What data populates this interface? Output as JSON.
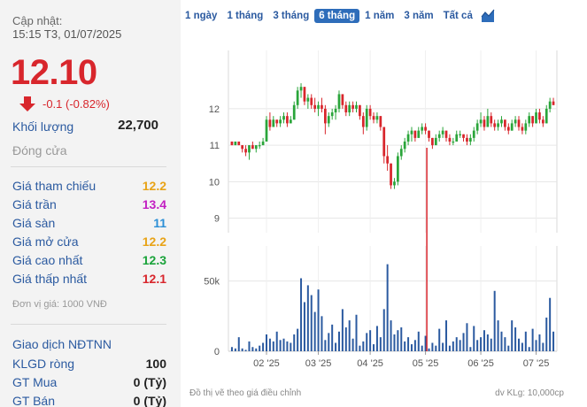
{
  "update": {
    "label": "Cập nhật:",
    "time": "15:15 T3, 01/07/2025"
  },
  "price": {
    "value": "12.10",
    "change": "-0.1 (-0.82%)"
  },
  "volume": {
    "label": "Khối lượng",
    "value": "22,700"
  },
  "close": {
    "label": "Đóng cửa"
  },
  "stats": [
    {
      "label": "Giá tham chiếu",
      "value": "12.2",
      "color": "#e8a317"
    },
    {
      "label": "Giá trần",
      "value": "13.4",
      "color": "#c21fc2"
    },
    {
      "label": "Giá sàn",
      "value": "11",
      "color": "#2b8fd6"
    },
    {
      "label": "Giá mở cửa",
      "value": "12.2",
      "color": "#e8a317"
    },
    {
      "label": "Giá cao nhất",
      "value": "12.3",
      "color": "#1aa33a"
    },
    {
      "label": "Giá thấp nhất",
      "value": "12.1",
      "color": "#d8262c"
    }
  ],
  "unit_note": "Đơn vị giá: 1000 VNĐ",
  "foreign": {
    "title": "Giao dịch NĐTNN",
    "rows": [
      {
        "label": "KLGD ròng",
        "value": "100"
      },
      {
        "label": "GT Mua",
        "value": "0 (Tỷ)"
      },
      {
        "label": "GT Bán",
        "value": "0 (Tỷ)"
      }
    ]
  },
  "tabs": [
    {
      "label": "1 ngày",
      "active": false
    },
    {
      "label": "1 tháng",
      "active": false
    },
    {
      "label": "3 tháng",
      "active": false
    },
    {
      "label": "6 tháng",
      "active": true
    },
    {
      "label": "1 năm",
      "active": false
    },
    {
      "label": "3 năm",
      "active": false
    },
    {
      "label": "Tất cả",
      "active": false
    }
  ],
  "chart_icon": "area-chart-icon",
  "footer": {
    "left": "Đồ thị vẽ theo giá điều chỉnh",
    "right": "dv KLg: 10,000cp"
  },
  "chart_data": {
    "type": "candlestick",
    "price_ticks": [
      "12",
      "11",
      "10",
      "9"
    ],
    "price_range": [
      8.6,
      13.6
    ],
    "volume_ticks": [
      "50k",
      "0"
    ],
    "volume_range": [
      0,
      75
    ],
    "x_ticks": [
      "02 '25",
      "03 '25",
      "04 '25",
      "05 '25",
      "06 '25",
      "07 '25"
    ],
    "colors": {
      "up": "#2aa53a",
      "down": "#d8262c",
      "volume": "#2b5aa0",
      "marker": "#d8262c"
    },
    "candles": [
      [
        11.1,
        11.1,
        11.0,
        11.0
      ],
      [
        11.0,
        11.1,
        11.0,
        11.1
      ],
      [
        11.1,
        11.1,
        11.0,
        11.0
      ],
      [
        11.0,
        11.0,
        10.8,
        10.9
      ],
      [
        10.9,
        11.0,
        10.7,
        10.8
      ],
      [
        10.8,
        11.0,
        10.6,
        11.0
      ],
      [
        11.0,
        11.1,
        10.9,
        10.9
      ],
      [
        10.9,
        11.0,
        10.8,
        11.0
      ],
      [
        11.0,
        11.1,
        10.9,
        11.0
      ],
      [
        11.0,
        11.2,
        11.0,
        11.1
      ],
      [
        11.1,
        11.8,
        11.1,
        11.7
      ],
      [
        11.7,
        11.9,
        11.4,
        11.5
      ],
      [
        11.5,
        11.8,
        11.5,
        11.7
      ],
      [
        11.7,
        11.7,
        11.5,
        11.6
      ],
      [
        11.6,
        11.8,
        11.5,
        11.7
      ],
      [
        11.7,
        11.9,
        11.6,
        11.8
      ],
      [
        11.8,
        11.9,
        11.5,
        11.6
      ],
      [
        11.6,
        11.8,
        11.6,
        11.7
      ],
      [
        11.7,
        12.2,
        11.7,
        12.1
      ],
      [
        12.1,
        12.6,
        12.0,
        12.5
      ],
      [
        12.5,
        12.7,
        12.3,
        12.6
      ],
      [
        12.6,
        12.6,
        12.1,
        12.2
      ],
      [
        12.2,
        12.4,
        12.0,
        12.3
      ],
      [
        12.3,
        12.4,
        12.0,
        12.1
      ],
      [
        12.1,
        12.3,
        11.9,
        12.0
      ],
      [
        12.0,
        12.2,
        11.8,
        12.1
      ],
      [
        12.1,
        12.3,
        11.9,
        12.0
      ],
      [
        12.0,
        12.1,
        11.3,
        11.6
      ],
      [
        11.6,
        11.9,
        11.5,
        11.8
      ],
      [
        11.8,
        12.0,
        11.7,
        11.9
      ],
      [
        11.9,
        12.1,
        11.7,
        12.0
      ],
      [
        12.0,
        12.5,
        11.9,
        12.4
      ],
      [
        12.4,
        12.4,
        12.0,
        12.1
      ],
      [
        12.1,
        12.2,
        11.8,
        11.9
      ],
      [
        11.9,
        12.2,
        11.8,
        12.1
      ],
      [
        12.1,
        12.2,
        11.9,
        12.0
      ],
      [
        12.0,
        12.2,
        11.9,
        12.1
      ],
      [
        12.1,
        12.1,
        11.7,
        11.8
      ],
      [
        11.8,
        11.9,
        11.3,
        11.5
      ],
      [
        11.5,
        12.1,
        11.4,
        12.0
      ],
      [
        12.0,
        12.1,
        11.7,
        11.8
      ],
      [
        11.8,
        11.9,
        11.6,
        11.7
      ],
      [
        11.7,
        11.9,
        11.6,
        11.8
      ],
      [
        11.8,
        11.8,
        11.4,
        11.5
      ],
      [
        11.5,
        11.5,
        10.5,
        10.7
      ],
      [
        10.7,
        11.0,
        10.3,
        10.5
      ],
      [
        10.5,
        10.5,
        9.8,
        9.9
      ],
      [
        9.9,
        10.1,
        9.8,
        10.0
      ],
      [
        10.0,
        10.8,
        9.9,
        10.7
      ],
      [
        10.7,
        11.0,
        10.6,
        10.9
      ],
      [
        10.9,
        11.2,
        10.8,
        11.1
      ],
      [
        11.1,
        11.4,
        11.0,
        11.3
      ],
      [
        11.3,
        11.5,
        11.1,
        11.4
      ],
      [
        11.4,
        11.4,
        11.1,
        11.2
      ],
      [
        11.2,
        11.5,
        11.2,
        11.4
      ],
      [
        11.4,
        11.6,
        11.3,
        11.5
      ],
      [
        11.5,
        11.6,
        11.3,
        11.4
      ],
      [
        11.4,
        11.4,
        11.1,
        11.2
      ],
      [
        11.2,
        11.2,
        10.9,
        11.0
      ],
      [
        11.0,
        11.3,
        11.0,
        11.2
      ],
      [
        11.2,
        11.4,
        11.1,
        11.3
      ],
      [
        11.3,
        11.5,
        11.2,
        11.4
      ],
      [
        11.4,
        11.4,
        11.1,
        11.2
      ],
      [
        11.2,
        11.3,
        11.0,
        11.1
      ],
      [
        11.1,
        11.2,
        11.0,
        11.1
      ],
      [
        11.1,
        11.4,
        11.1,
        11.3
      ],
      [
        11.3,
        11.4,
        11.2,
        11.3
      ],
      [
        11.3,
        11.3,
        11.1,
        11.2
      ],
      [
        11.2,
        11.3,
        11.0,
        11.1
      ],
      [
        11.1,
        11.3,
        11.0,
        11.2
      ],
      [
        11.2,
        11.5,
        11.1,
        11.4
      ],
      [
        11.4,
        11.7,
        11.3,
        11.6
      ],
      [
        11.6,
        11.9,
        11.5,
        11.7
      ],
      [
        11.7,
        11.8,
        11.4,
        11.5
      ],
      [
        11.5,
        12.0,
        11.5,
        11.8
      ],
      [
        11.8,
        11.9,
        11.5,
        11.6
      ],
      [
        11.6,
        11.7,
        11.4,
        11.5
      ],
      [
        11.5,
        11.7,
        11.4,
        11.6
      ],
      [
        11.6,
        11.8,
        11.5,
        11.7
      ],
      [
        11.7,
        11.7,
        11.4,
        11.5
      ],
      [
        11.5,
        11.6,
        11.3,
        11.4
      ],
      [
        11.4,
        11.7,
        11.4,
        11.6
      ],
      [
        11.6,
        11.8,
        11.5,
        11.7
      ],
      [
        11.7,
        11.8,
        11.4,
        11.5
      ],
      [
        11.5,
        11.6,
        11.3,
        11.4
      ],
      [
        11.4,
        11.7,
        11.3,
        11.6
      ],
      [
        11.6,
        11.9,
        11.5,
        11.8
      ],
      [
        11.8,
        11.8,
        11.5,
        11.6
      ],
      [
        11.6,
        12.0,
        11.6,
        11.9
      ],
      [
        11.9,
        12.0,
        11.6,
        11.7
      ],
      [
        11.7,
        11.8,
        11.5,
        11.6
      ],
      [
        11.6,
        12.1,
        11.6,
        12.0
      ],
      [
        12.0,
        12.3,
        11.9,
        12.2
      ],
      [
        12.2,
        12.3,
        12.1,
        12.1
      ]
    ],
    "volumes": [
      3,
      2,
      10,
      2,
      1,
      7,
      3,
      2,
      4,
      6,
      12,
      9,
      7,
      14,
      8,
      9,
      7,
      6,
      12,
      16,
      52,
      35,
      47,
      40,
      28,
      44,
      25,
      8,
      13,
      19,
      6,
      14,
      30,
      17,
      22,
      9,
      26,
      4,
      7,
      13,
      15,
      5,
      18,
      10,
      30,
      62,
      22,
      12,
      15,
      17,
      7,
      10,
      5,
      8,
      14,
      4,
      11,
      2,
      6,
      4,
      16,
      6,
      22,
      4,
      7,
      10,
      8,
      13,
      20,
      3,
      18,
      8,
      10,
      15,
      12,
      9,
      43,
      22,
      14,
      10,
      4,
      22,
      17,
      9,
      6,
      14,
      3,
      16,
      8,
      12,
      6,
      24,
      38,
      14,
      18,
      22,
      12,
      28,
      20
    ]
  }
}
